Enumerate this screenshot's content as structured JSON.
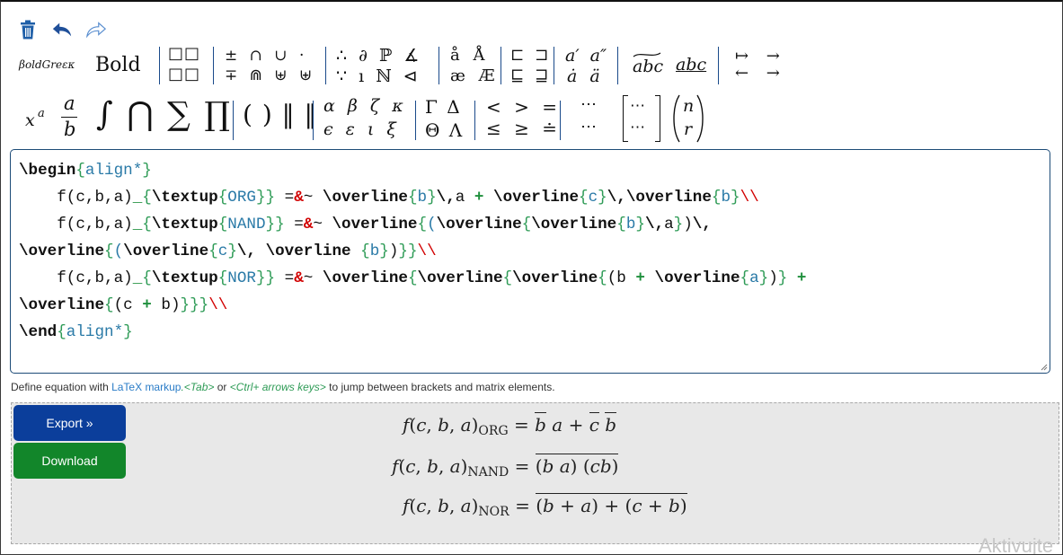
{
  "toolbar": {
    "style_bold_greek": "βoldGreεκ",
    "style_bold": "Bold",
    "groups": {
      "boxes": [
        "□□",
        "□□"
      ],
      "ops1": [
        "± ∩ ∪ ·",
        "∓ ⋒ ⊎ ⊎"
      ],
      "logic": [
        "∴ ∂ ℙ ∡",
        "∵ ı ℕ ⊲"
      ],
      "ring": [
        "å Å",
        "æ Æ"
      ],
      "sq": [
        "⊏ ⊐",
        "⊑ ⊒"
      ],
      "prime": [
        "a′ a″",
        "ȧ ä"
      ],
      "over": [
        "abc",
        "abc"
      ],
      "arrows": [
        "↦ →",
        "← →"
      ],
      "power": "x",
      "power_exp": "a",
      "frac_num": "a",
      "frac_den": "b",
      "bigops": "∫ ⋂ ∑ ∏",
      "brackets": "( ) ‖ ‖",
      "greek_lower": [
        "α β ζ κ",
        "ϵ ε ι ξ"
      ],
      "greek_upper": [
        "Γ Δ",
        "Θ Λ"
      ],
      "relations": [
        "< > =",
        "≤ ≥ ≐"
      ],
      "dots": [
        "⋯",
        "⋯"
      ],
      "matrix": [
        "⋯",
        "⋯"
      ],
      "binom": [
        "n",
        "r"
      ]
    }
  },
  "editor": {
    "lines": [
      "\\begin{align*}",
      "    f(c,b,a)_{\\textup{ORG}} =&~ \\overline{b}\\,a + \\overline{c}\\,\\overline{b}\\\\",
      "    f(c,b,a)_{\\textup{NAND}} =&~ \\overline{(\\overline{\\overline{b}\\,a})\\,",
      "\\overline{(\\overline{c}\\, \\overline {b})}}\\\\",
      "    f(c,b,a)_{\\textup{NOR}} =&~ \\overline{\\overline{\\overline{(b + \\overline{a})} +",
      "\\overline{(c + b)}}}\\\\",
      "\\end{align*}"
    ]
  },
  "hint": {
    "prefix": "Define equation with ",
    "link": "LaTeX markup",
    "tab": ".<Tab>",
    "or": " or ",
    "keys": "<Ctrl+ arrows keys>",
    "suffix": " to jump between brackets and matrix elements."
  },
  "buttons": {
    "export": "Export »",
    "download": "Download"
  },
  "preview": {
    "eq1_lhs": "f(c, b, a)",
    "eq1_sub": "ORG",
    "eq1_rhs": "= b a + c b",
    "eq2_lhs": "f(c, b, a)",
    "eq2_sub": "NAND",
    "eq2_rhs": "= (b a) (c b)",
    "eq3_lhs": "f(c, b, a)",
    "eq3_sub": "NOR",
    "eq3_rhs": "= (b + a) + (c + b)"
  },
  "watermark": "Aktivujte",
  "colors": {
    "accent_blue": "#0b3e9b",
    "accent_green": "#12862a",
    "latex_keyword": "#111111",
    "latex_brace": "#2e9b56",
    "latex_arg": "#2a7aa7",
    "latex_amp": "#d10000"
  }
}
